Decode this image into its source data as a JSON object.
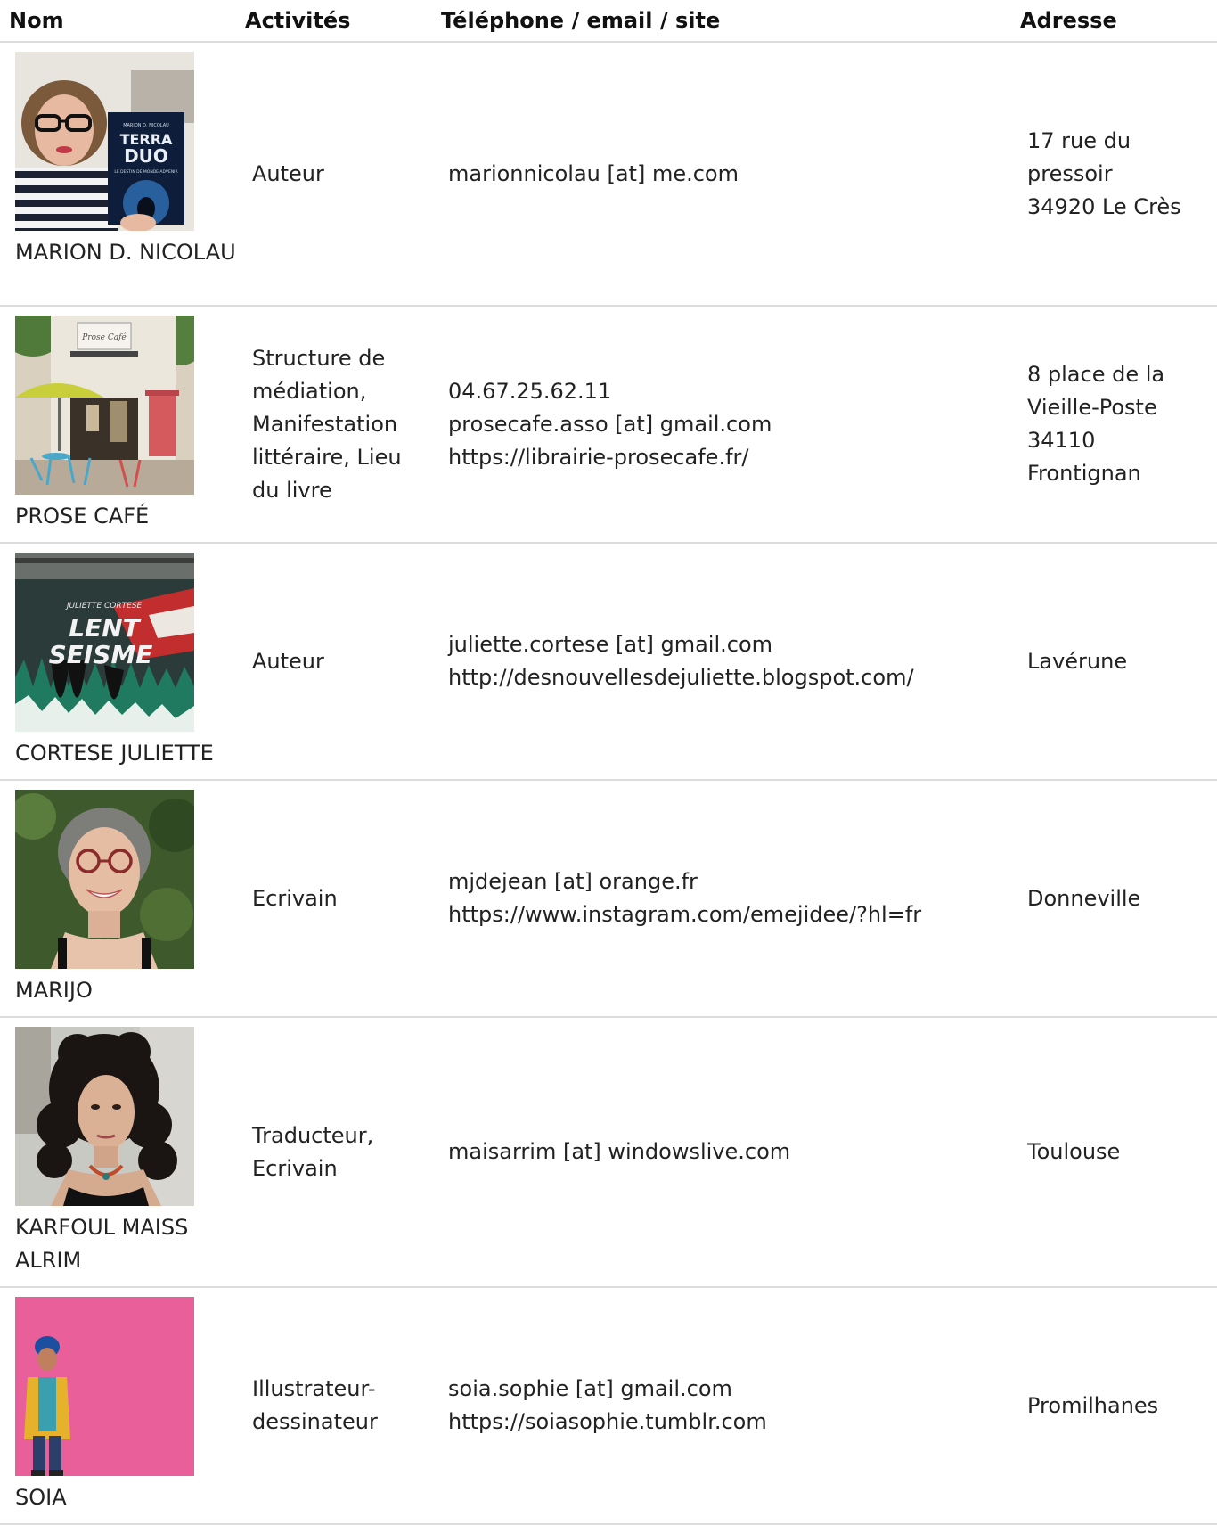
{
  "headers": {
    "nom": "Nom",
    "activites": "Activités",
    "contact": "Téléphone / email / site",
    "adresse": "Adresse"
  },
  "rows": [
    {
      "name": "MARION D. NICOLAU",
      "activities": "Auteur",
      "contact": [
        "marionnicolau [at] me.com"
      ],
      "address": [
        "17 rue du pressoir",
        "34920 Le Crès"
      ],
      "photo_book_title": "TERRA DUO",
      "photo_book_author": "MARION D. NICOLAU",
      "photo_book_subtitle": "LE DESTIN DE MONDE ADVENIR"
    },
    {
      "name": "PROSE CAFÉ",
      "activities": "Structure de médiation, Manifestation littéraire, Lieu du livre",
      "contact": [
        "04.67.25.62.11",
        "prosecafe.asso [at] gmail.com",
        "https://librairie-prosecafe.fr/"
      ],
      "address": [
        "8 place de la Vieille-Poste",
        "34110 Frontignan"
      ],
      "photo_sign": "Prose Café"
    },
    {
      "name": "CORTESE JULIETTE",
      "activities": "Auteur",
      "contact": [
        "juliette.cortese [at] gmail.com",
        "http://desnouvellesdejuliette.blogspot.com/"
      ],
      "address": [
        "Lavérune"
      ],
      "photo_book_author": "JULIETTE CORTESE",
      "photo_book_title_1": "LENT",
      "photo_book_title_2": "SEISME"
    },
    {
      "name": "MARIJO",
      "activities": "Ecrivain",
      "contact": [
        "mjdejean [at] orange.fr",
        "https://www.instagram.com/emejidee/?hl=fr"
      ],
      "address": [
        "Donneville"
      ]
    },
    {
      "name": "KARFOUL MAISS ALRIM",
      "activities": "Traducteur, Ecrivain",
      "contact": [
        "maisarrim [at] windowslive.com"
      ],
      "address": [
        "Toulouse"
      ]
    },
    {
      "name": "SOIA",
      "activities": "Illustrateur-dessinateur",
      "contact": [
        "soia.sophie [at] gmail.com",
        "https://soiasophie.tumblr.com"
      ],
      "address": [
        "Promilhanes"
      ]
    }
  ]
}
